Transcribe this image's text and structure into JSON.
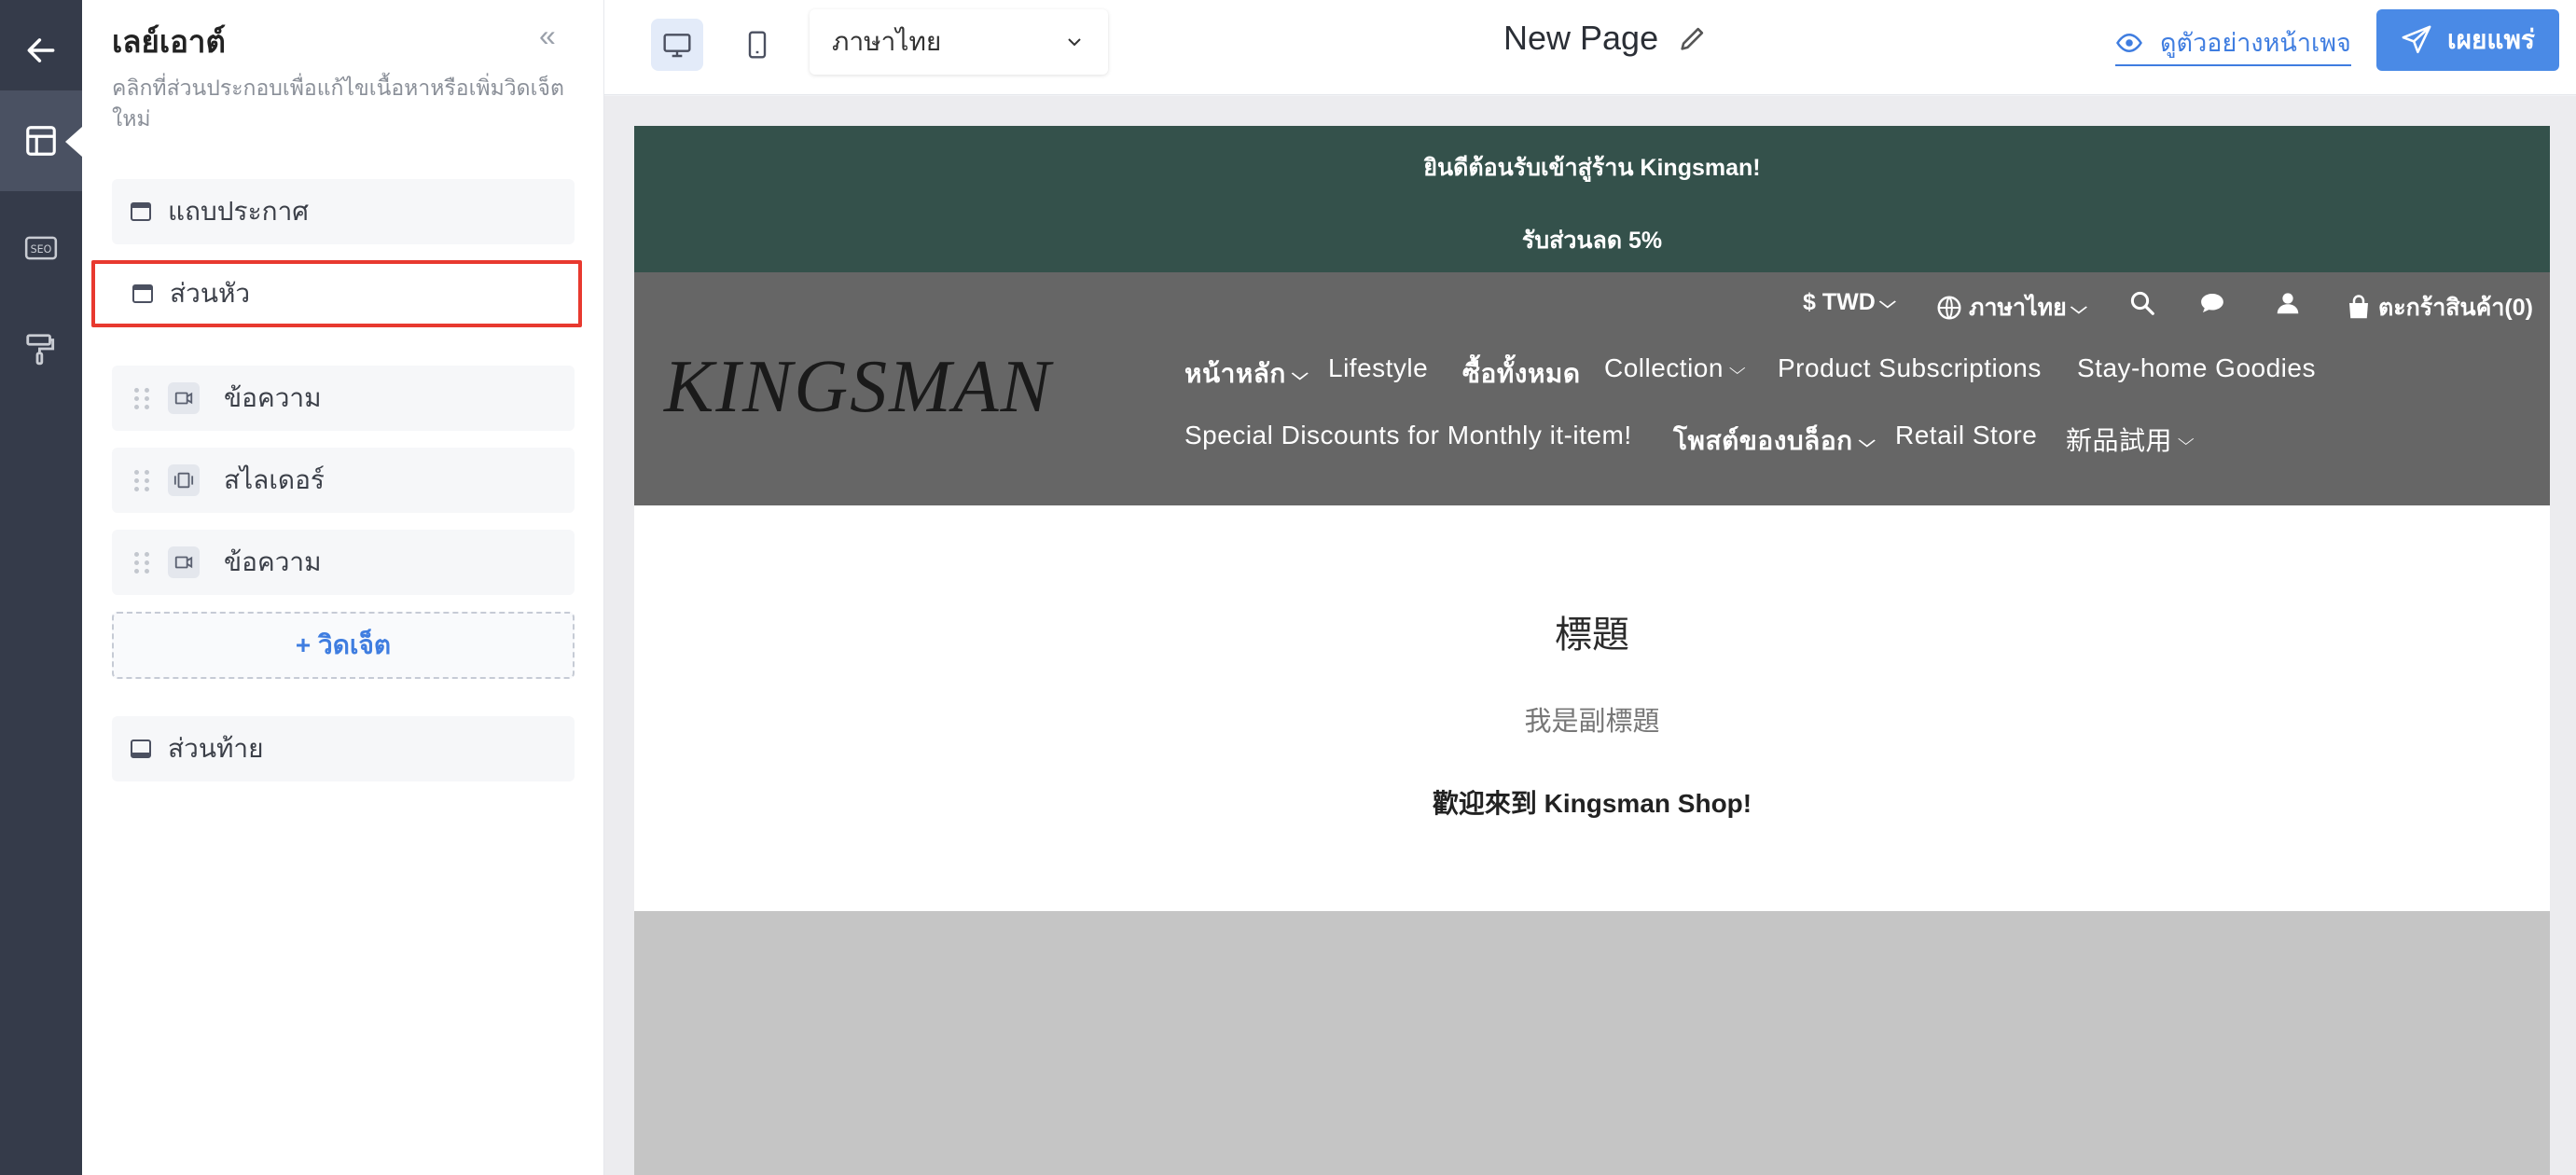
{
  "rail": {
    "items": [
      "back-arrow-icon",
      "layout-icon",
      "seo-icon",
      "paint-roller-icon"
    ],
    "seo_text": "SEO"
  },
  "panel": {
    "title": "เลย์เอาต์",
    "collapse": "«",
    "description": "คลิกที่ส่วนประกอบเพื่อแก้ไขเนื้อหาหรือเพิ่มวิดเจ็ตใหม่",
    "announcement_bar": "แถบประกาศ",
    "header": "ส่วนหัว",
    "widgets": [
      {
        "label": "ข้อความ",
        "icon": "text-widget-icon"
      },
      {
        "label": "สไลเดอร์",
        "icon": "slider-widget-icon"
      },
      {
        "label": "ข้อความ",
        "icon": "text-widget-icon"
      }
    ],
    "add_widget": "+ วิดเจ็ต",
    "footer": "ส่วนท้าย"
  },
  "topbar": {
    "language": "ภาษาไทย",
    "page_title": "New Page",
    "preview_label": "ดูตัวอย่างหน้าเพจ",
    "publish_label": "เผยแพร่"
  },
  "store": {
    "announcement_line1": "ยินดีต้อนรับเข้าสู่ร้าน Kingsman!",
    "announcement_line2": "รับส่วนลด 5%",
    "logo": "KINGSMAN",
    "currency": "$ TWD",
    "language": "ภาษาไทย",
    "cart": "ตะกร้าสินค้า(0)",
    "nav_row1": [
      "หน้าหลัก",
      "Lifestyle",
      "ซื้อทั้งหมด",
      "Collection",
      "Product Subscriptions",
      "Stay-home Goodies"
    ],
    "nav_row2": [
      "Special Discounts for Monthly it-item!",
      "โพสต์ของบล็อก",
      "Retail Store",
      "新品試用"
    ],
    "hero_title": "標題",
    "hero_subtitle": "我是副標題",
    "hero_text": "歡迎來到 Kingsman Shop!"
  },
  "colors": {
    "rail_bg": "#353b4a",
    "announce_bg": "#34514b",
    "header_bg": "#666666",
    "accent": "#3f7de0",
    "selected_border": "#e8392f"
  }
}
